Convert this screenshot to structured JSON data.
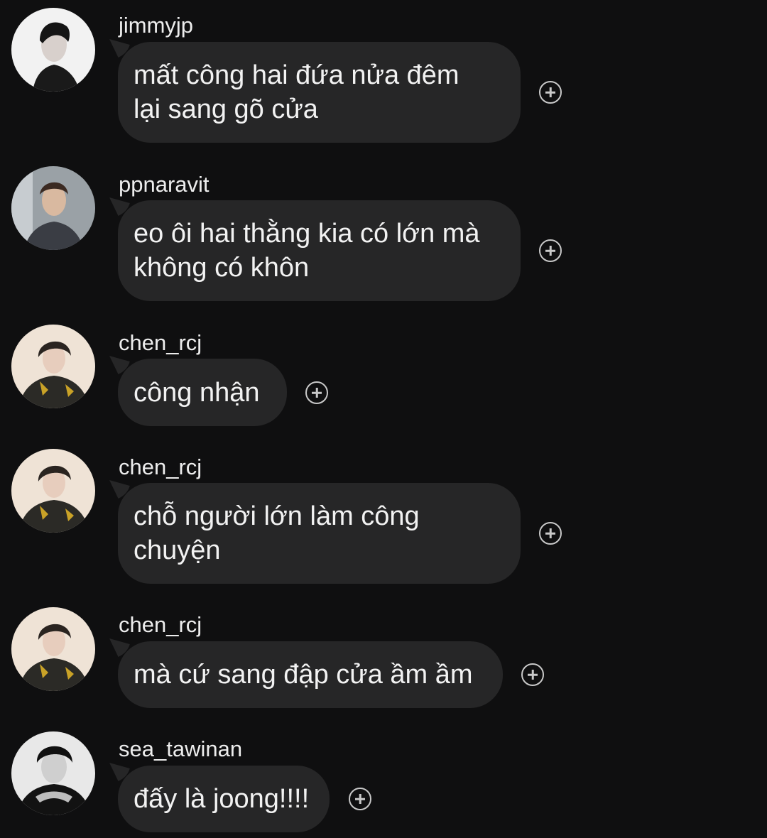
{
  "messages": [
    {
      "username": "jimmyjp",
      "lines": [
        "mất công hai đứa nửa đêm",
        "lại sang gõ cửa"
      ],
      "avatar": "jimmyjp-avatar",
      "react_icon": "add-reaction-icon"
    },
    {
      "username": "ppnaravit",
      "lines": [
        "eo ôi hai thằng kia có lớn mà",
        "không có khôn"
      ],
      "avatar": "ppnaravit-avatar",
      "react_icon": "add-reaction-icon"
    },
    {
      "username": "chen_rcj",
      "lines": [
        "công nhận"
      ],
      "avatar": "chen_rcj-avatar",
      "react_icon": "add-reaction-icon"
    },
    {
      "username": "chen_rcj",
      "lines": [
        "chỗ người lớn làm công",
        "chuyện"
      ],
      "avatar": "chen_rcj-avatar",
      "react_icon": "add-reaction-icon"
    },
    {
      "username": "chen_rcj",
      "lines": [
        "mà cứ sang đập cửa ầm ầm"
      ],
      "avatar": "chen_rcj-avatar",
      "react_icon": "add-reaction-icon"
    },
    {
      "username": "sea_tawinan",
      "lines": [
        "đấy là joong!!!!"
      ],
      "avatar": "sea_tawinan-avatar",
      "react_icon": "add-reaction-icon"
    }
  ],
  "colors": {
    "background": "#0f0f10",
    "bubble": "#262627",
    "text": "#f2f2f2",
    "icon": "#c9c9c9"
  }
}
